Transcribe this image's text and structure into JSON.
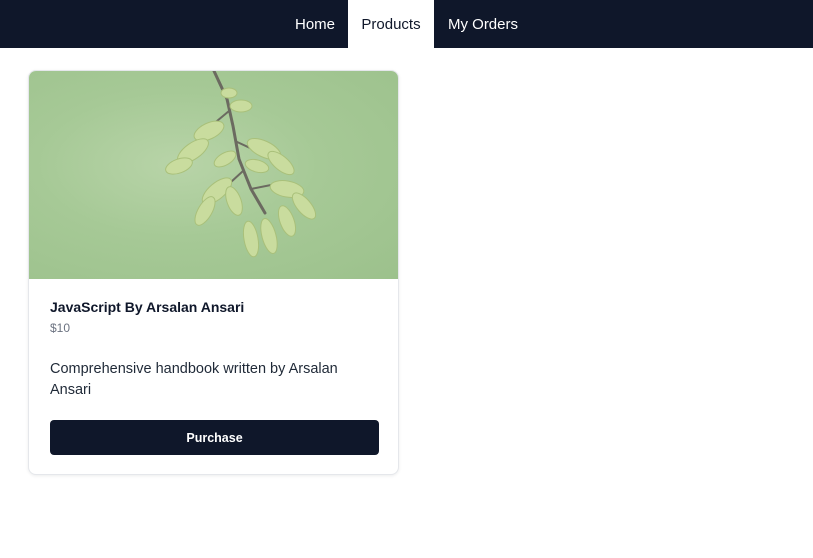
{
  "nav": {
    "items": [
      {
        "label": "Home",
        "active": false
      },
      {
        "label": "Products",
        "active": true
      },
      {
        "label": "My Orders",
        "active": false
      }
    ]
  },
  "product": {
    "title": "JavaScript By Arsalan Ansari",
    "price": "$10",
    "description": "Comprehensive handbook written by Arsalan Ansari",
    "button_label": "Purchase",
    "image": "green-branch-catkins-photo"
  },
  "colors": {
    "nav_bg": "#0f172a",
    "button_bg": "#0f172a",
    "active_tab_bg": "#ffffff"
  }
}
